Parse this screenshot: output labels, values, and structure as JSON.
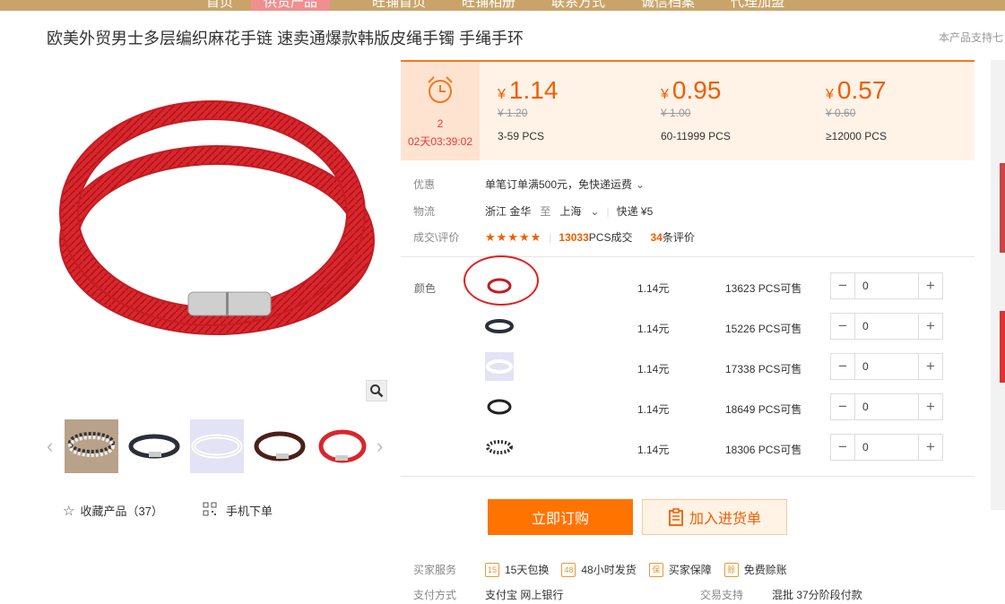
{
  "nav": {
    "items": [
      "首页",
      "供货产品",
      "旺铺首页",
      "旺铺相册",
      "联系方式",
      "诚信档案",
      "代理加盟"
    ]
  },
  "product": {
    "title": "欧美外贸男士多层编织麻花手链 速卖通爆款韩版皮绳手镯 手绳手环",
    "support_text": "本产品支持七"
  },
  "timer": {
    "days": "2",
    "countdown": "02天03:39:02"
  },
  "prices": [
    {
      "price": "1.14",
      "old": "¥ 1.20",
      "range": "3-59  PCS"
    },
    {
      "price": "0.95",
      "old": "¥ 1.00",
      "range": "60-11999  PCS"
    },
    {
      "price": "0.57",
      "old": "¥ 0.60",
      "range": "≥12000  PCS"
    }
  ],
  "currency": "¥",
  "promo": {
    "label": "优惠",
    "value": "单笔订单满500元，免快递运费"
  },
  "logistics": {
    "label": "物流",
    "from": "浙江 金华",
    "to_word": "至",
    "to": "上海",
    "method": "快递 ¥5"
  },
  "deals": {
    "label": "成交\\评价",
    "stars": "★★★★★",
    "count": "13033",
    "count_suffix": "PCS成交",
    "reviews": "34",
    "reviews_suffix": "条评价"
  },
  "color_label": "颜色",
  "skus": [
    {
      "price": "1.14元",
      "stock": "13623 PCS可售",
      "qty": "0"
    },
    {
      "price": "1.14元",
      "stock": "15226 PCS可售",
      "qty": "0"
    },
    {
      "price": "1.14元",
      "stock": "17338 PCS可售",
      "qty": "0"
    },
    {
      "price": "1.14元",
      "stock": "18649 PCS可售",
      "qty": "0"
    },
    {
      "price": "1.14元",
      "stock": "18306 PCS可售",
      "qty": "0"
    }
  ],
  "buttons": {
    "buy": "立即订购",
    "cart": "加入进货单"
  },
  "side_actions": {
    "favorite": "收藏产品（37）",
    "mobile": "手机下单"
  },
  "services": {
    "label": "买家服务",
    "items": [
      "15天包换",
      "48小时发货",
      "买家保障",
      "免费赊账"
    ]
  },
  "payment": {
    "label": "支付方式",
    "methods": "支付宝  网上银行",
    "trade_label": "交易支持",
    "trade_values": "混批   37分阶段付款"
  },
  "colors": {
    "accent": "#ff7300",
    "price": "#f25c00",
    "nav": "#c9a46a",
    "circle": "#e02020"
  }
}
